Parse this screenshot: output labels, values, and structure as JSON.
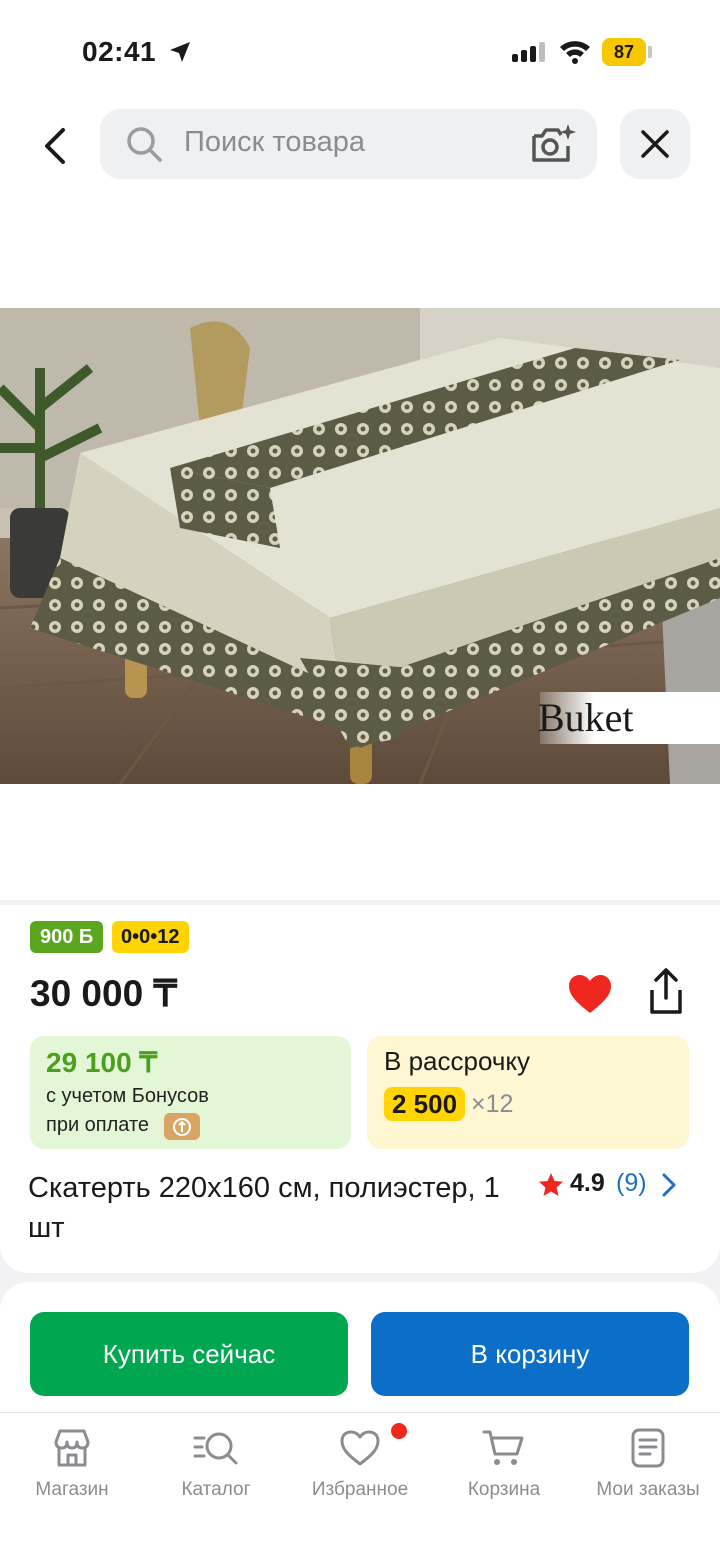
{
  "status_bar": {
    "time": "02:41",
    "battery": "87"
  },
  "search": {
    "placeholder": "Поиск товара"
  },
  "product": {
    "image_caption": "Buket",
    "bonus_badge": "900 Б",
    "installment_badge": "0•0•12",
    "price": "30 000 ₸",
    "bonus_price": "29 100 ₸",
    "bonus_note_line1": "с учетом Бонусов",
    "bonus_note_line2": "при оплате",
    "installment_title": "В рассрочку",
    "installment_amount": "2 500",
    "installment_months": "×12",
    "title": "Скатерть 220x160 см, полиэстер, 1 шт",
    "rating": "4.9",
    "reviews": "(9)"
  },
  "actions": {
    "buy_now": "Купить сейчас",
    "add_to_cart": "В корзину"
  },
  "tabbar": [
    {
      "label": "Магазин",
      "icon": "store-icon"
    },
    {
      "label": "Каталог",
      "icon": "catalog-search-icon"
    },
    {
      "label": "Избранное",
      "icon": "heart-outline-icon"
    },
    {
      "label": "Корзина",
      "icon": "cart-icon"
    },
    {
      "label": "Мои заказы",
      "icon": "orders-icon"
    }
  ],
  "colors": {
    "green": "#00a650",
    "blue": "#0b6fc8",
    "bonus_green": "#5aa61e",
    "yellow": "#ffd400",
    "heart": "#f0271f"
  }
}
